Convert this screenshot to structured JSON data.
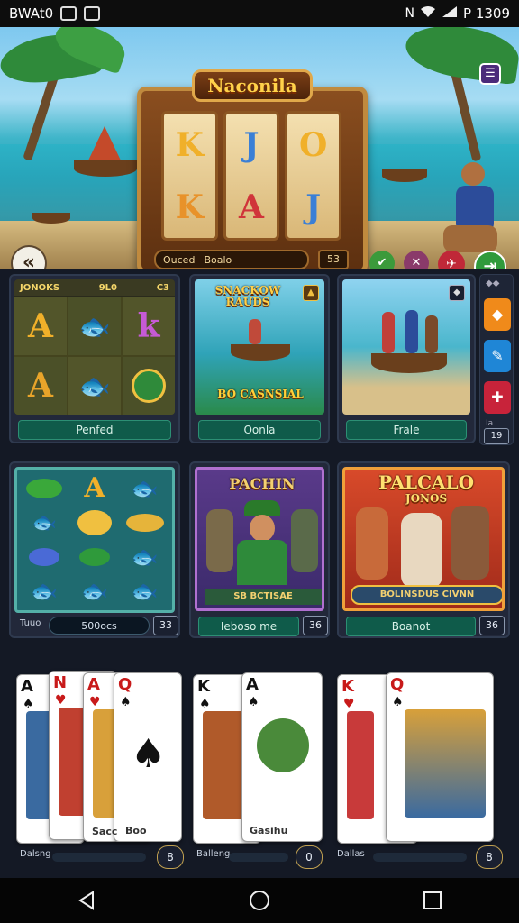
{
  "status_bar": {
    "left_text": "BWAt0",
    "right_text": "P 1309"
  },
  "hero": {
    "machine_title": "Naconila",
    "reel_symbols": [
      [
        "K",
        "K"
      ],
      [
        "J",
        "A"
      ],
      [
        "O",
        "J"
      ]
    ],
    "bar_left": "Ouced",
    "bar_value": "Boalo",
    "bar_button": "53"
  },
  "cards": [
    {
      "header_left": "JONOKS",
      "header_mid": "9L0",
      "header_right": "C3",
      "label": "Penfed",
      "reel_letters": [
        "A",
        "",
        "k",
        "A",
        "",
        ""
      ]
    },
    {
      "title": "SNACKOW RAUDS",
      "subtitle": "BO CASNSIAL",
      "label": "Oonla",
      "corner": "▲"
    },
    {
      "label": "Frale",
      "corner": "◆"
    },
    {
      "label_left": "Tuuo",
      "input_value": "500ocs",
      "counter": "33",
      "reel_letters": [
        "",
        "A",
        ""
      ]
    },
    {
      "title": "PACHIN",
      "subtitle": "SB BCTISAE",
      "label": "Ieboso me",
      "counter": "36"
    },
    {
      "title": "PALCALO",
      "title2": "JONOS",
      "subtitle": "BOLINSDUS CIVNN",
      "label": "Boanot",
      "counter": "36"
    }
  ],
  "side_strip": {
    "top_label": "◆◆",
    "bottom_label": "Ia",
    "bottom_counter": "19"
  },
  "bottom_cards": [
    {
      "label": "Dalsng",
      "counter": "8",
      "ranks": [
        "A",
        "N",
        "A",
        "Q"
      ]
    },
    {
      "label": "Balleng",
      "counter": "0",
      "ranks": [
        "K",
        "A"
      ],
      "caption": "Gasihu"
    },
    {
      "label": "Dallas",
      "counter": "8",
      "ranks": [
        "K",
        "Q"
      ]
    }
  ],
  "card_captions": {
    "first": "Sacc",
    "first_b": "Boo"
  },
  "colors": {
    "accent_green": "#0f5b4a",
    "gold": "#ffd048",
    "bg": "#141925"
  }
}
